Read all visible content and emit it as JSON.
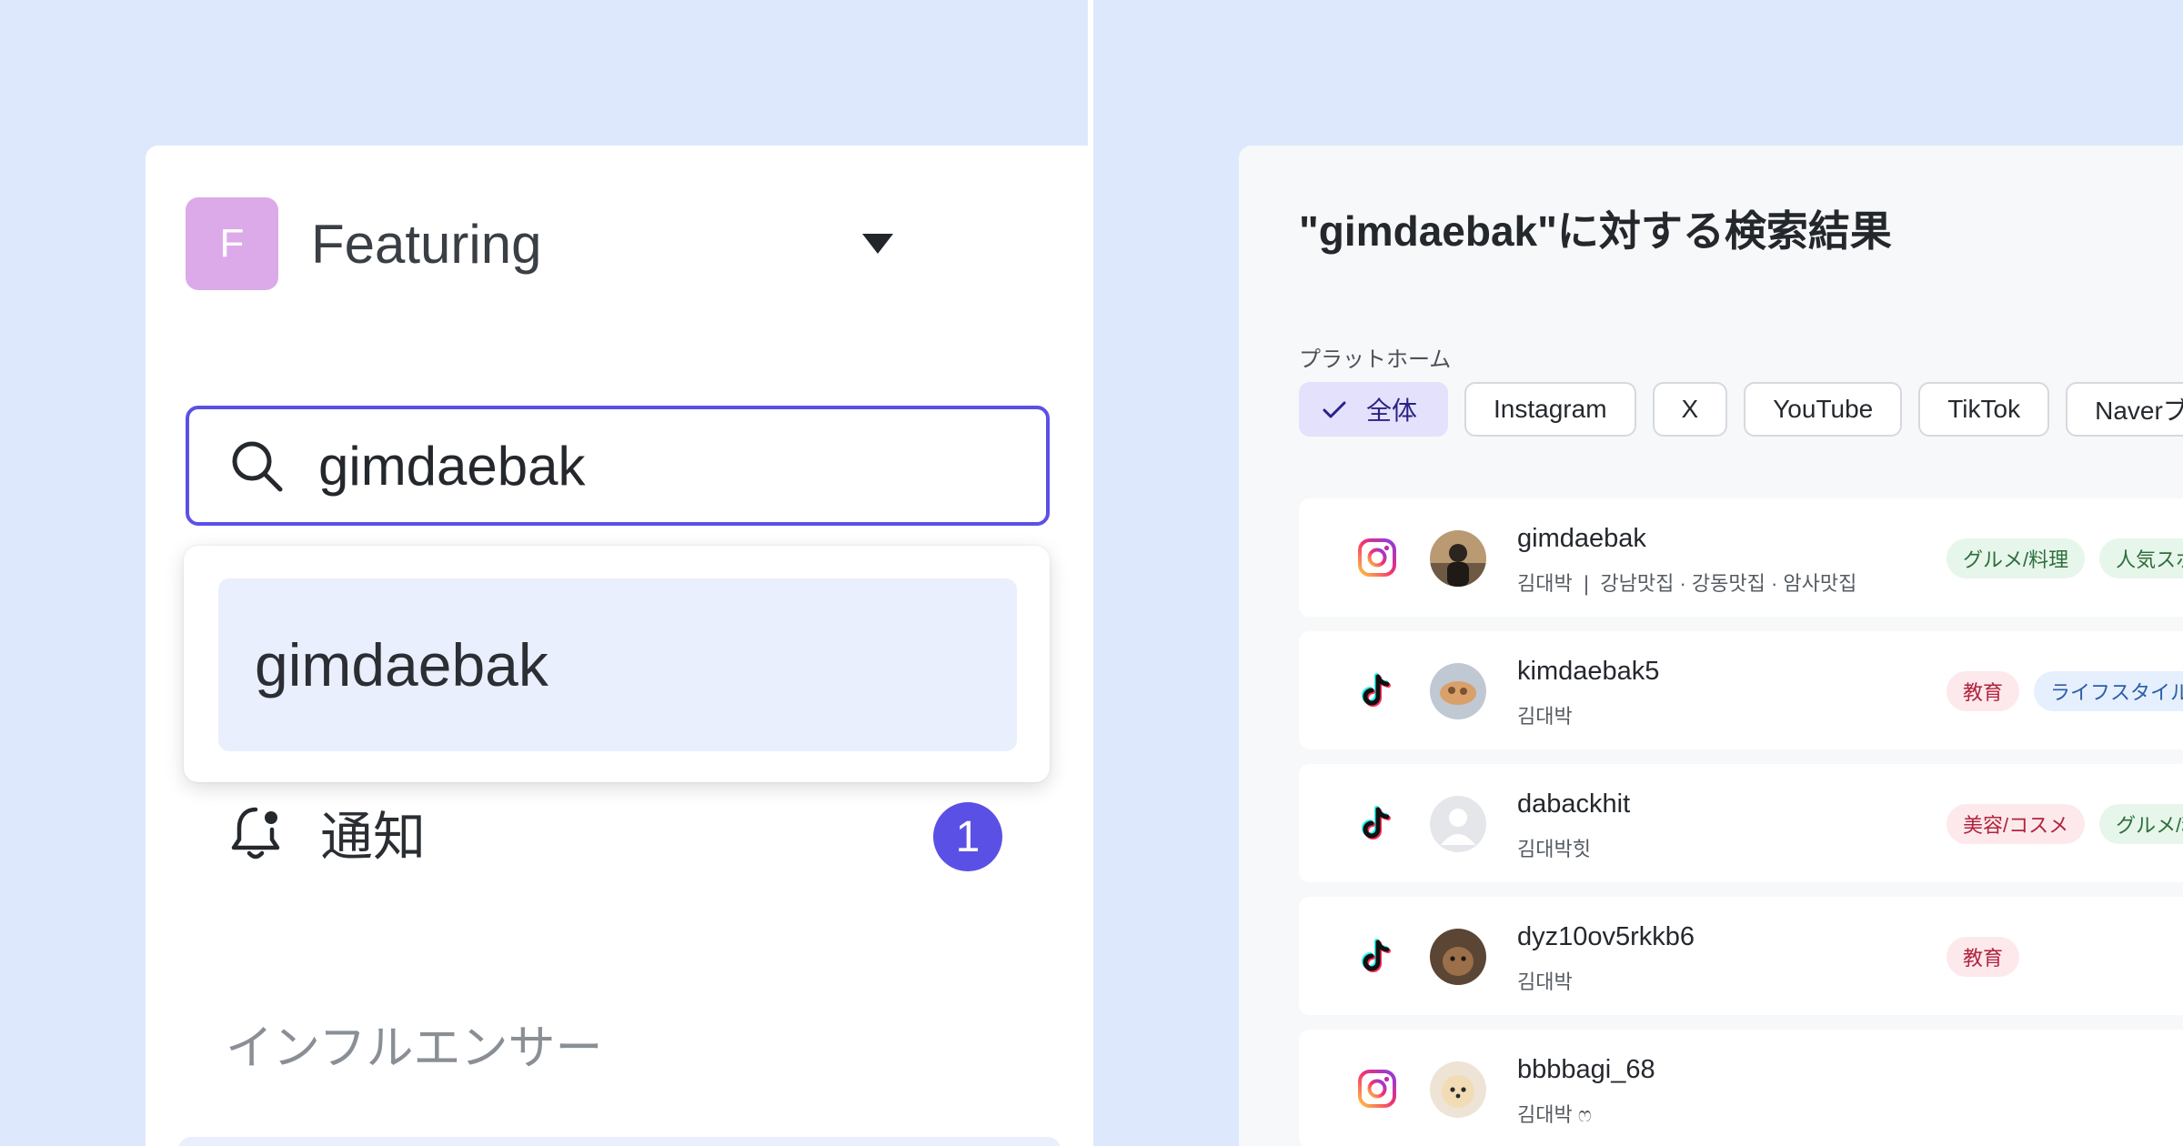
{
  "workspace": {
    "avatar_letter": "F",
    "name": "Featuring"
  },
  "search": {
    "value": "gimdaebak",
    "placeholder": ""
  },
  "dropdown": {
    "suggestion": "gimdaebak"
  },
  "notifications": {
    "label": "通知",
    "count": "1"
  },
  "sidebar": {
    "section_label": "インフルエンサー"
  },
  "results": {
    "title": "\"gimdaebak\"に対する検索結果",
    "platform_label": "プラットホーム",
    "filters": [
      "全体",
      "Instagram",
      "X",
      "YouTube",
      "TikTok",
      "Naverブ"
    ],
    "selected_filter": "全体",
    "items": [
      {
        "platform": "instagram-icon",
        "username": "gimdaebak",
        "subtitle": "김대박  ❘  강남맛집 · 강동맛집 · 암사맛집",
        "tags": [
          {
            "text": "グルメ/料理",
            "tone": "green"
          },
          {
            "text": "人気スポ",
            "tone": "green"
          }
        ]
      },
      {
        "platform": "tiktok-icon",
        "username": "kimdaebak5",
        "subtitle": "김대박",
        "tags": [
          {
            "text": "教育",
            "tone": "red"
          },
          {
            "text": "ライフスタイル",
            "tone": "blue"
          }
        ]
      },
      {
        "platform": "tiktok-icon",
        "username": "dabackhit",
        "subtitle": "김대박힛",
        "tags": [
          {
            "text": "美容/コスメ",
            "tone": "red"
          },
          {
            "text": "グルメ/料",
            "tone": "green"
          }
        ]
      },
      {
        "platform": "tiktok-icon",
        "username": "dyz10ov5rkkb6",
        "subtitle": "김대박",
        "tags": [
          {
            "text": "教育",
            "tone": "red"
          }
        ]
      },
      {
        "platform": "instagram-icon",
        "username": "bbbbagi_68",
        "subtitle": "김대박 ෆ",
        "tags": []
      }
    ]
  },
  "colors": {
    "accent": "#5b50e6",
    "page_bg": "#dde8fd",
    "workspace_avatar": "#dcaae9",
    "selected_chip_bg": "#e4e1fc",
    "suggestion_bg": "#eaeffe"
  }
}
